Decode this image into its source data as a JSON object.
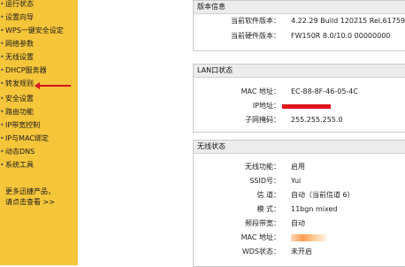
{
  "sidebar": {
    "items": [
      {
        "label": "运行状态"
      },
      {
        "label": "设置向导"
      },
      {
        "label": "WPS一键安全设定"
      },
      {
        "label": "网络参数"
      },
      {
        "label": "无线设置"
      },
      {
        "label": "DHCP服务器"
      },
      {
        "label": "转发规则"
      },
      {
        "label": "安全设置"
      },
      {
        "label": "路由功能"
      },
      {
        "label": "IP带宽控制"
      },
      {
        "label": "IP与MAC绑定"
      },
      {
        "label": "动态DNS"
      },
      {
        "label": "系统工具"
      }
    ],
    "bullet": "•",
    "footer": {
      "line1": "更多迅捷产品，",
      "line2": "请点击查看 >>"
    }
  },
  "version_panel": {
    "title": "版本信息",
    "rows": [
      {
        "label": "当前软件版本：",
        "value": "4.22.29 Build 120215 Rel.61759n"
      },
      {
        "label": "当前硬件版本：",
        "value": "FW150R 8.0/10.0 00000000"
      }
    ]
  },
  "lan_panel": {
    "title": "LAN口状态",
    "rows": [
      {
        "label": "MAC 地址：",
        "value": "EC-88-8F-46-05-4C"
      },
      {
        "label": "IP地址：",
        "value": ""
      },
      {
        "label": "子网掩码：",
        "value": "255.255.255.0"
      }
    ]
  },
  "wireless_panel": {
    "title": "无线状态",
    "rows": [
      {
        "label": "无线功能：",
        "value": "启用"
      },
      {
        "label": "SSID号：",
        "value": "Yui"
      },
      {
        "label": "信 道：",
        "value": "自动（当前信道 6）"
      },
      {
        "label": "模 式：",
        "value": "11bgn mixed"
      },
      {
        "label": "频段带宽：",
        "value": "自动"
      },
      {
        "label": "MAC 地址：",
        "value": ""
      },
      {
        "label": "WDS状态：",
        "value": "未开启"
      }
    ]
  },
  "colors": {
    "sidebar_bg": "#f5c53a",
    "annotation_red": "#d8121f"
  }
}
